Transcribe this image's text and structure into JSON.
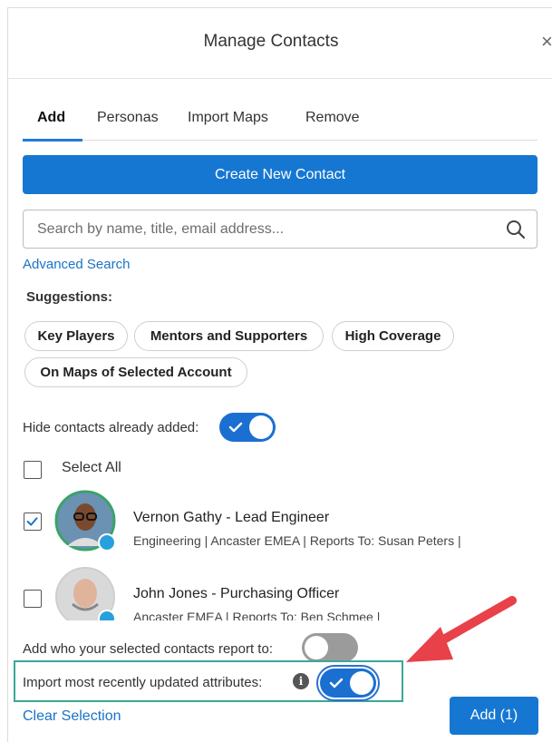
{
  "header": {
    "title": "Manage Contacts",
    "close_glyph": "×"
  },
  "tabs": [
    {
      "label": "Add",
      "active": true
    },
    {
      "label": "Personas",
      "active": false
    },
    {
      "label": "Import Maps",
      "active": false
    },
    {
      "label": "Remove",
      "active": false
    }
  ],
  "create_button_label": "Create New Contact",
  "search": {
    "placeholder": "Search by name, title, email address...",
    "value": ""
  },
  "advanced_search_label": "Advanced Search",
  "suggestions": {
    "label": "Suggestions:",
    "chips": [
      "Key Players",
      "Mentors and Supporters",
      "High Coverage",
      "On Maps of Selected Account"
    ]
  },
  "hide_contacts": {
    "label": "Hide contacts already added:",
    "enabled": true
  },
  "select_all_label": "Select All",
  "contacts": [
    {
      "name_title": "Vernon Gathy  - Lead Engineer",
      "meta": "Engineering | Ancaster EMEA | Reports To: Susan Peters |",
      "checked": true,
      "ring_color": "#3aa36a"
    },
    {
      "name_title": "John Jones  - Purchasing Officer",
      "meta": "Ancaster EMEA | Reports To: Ben Schmee |",
      "checked": false,
      "ring_color": "#d0d0d0"
    }
  ],
  "reports_to": {
    "label": "Add who your selected contacts report to:",
    "enabled": false
  },
  "import_attributes": {
    "label": "Import most recently updated attributes:",
    "enabled": true
  },
  "clear_selection_label": "Clear Selection",
  "add_button_label": "Add (1)",
  "colors": {
    "primary": "#1677d2",
    "link": "#1a73c7",
    "highlight_border": "#3aa897",
    "annotation_arrow": "#e8414a"
  }
}
